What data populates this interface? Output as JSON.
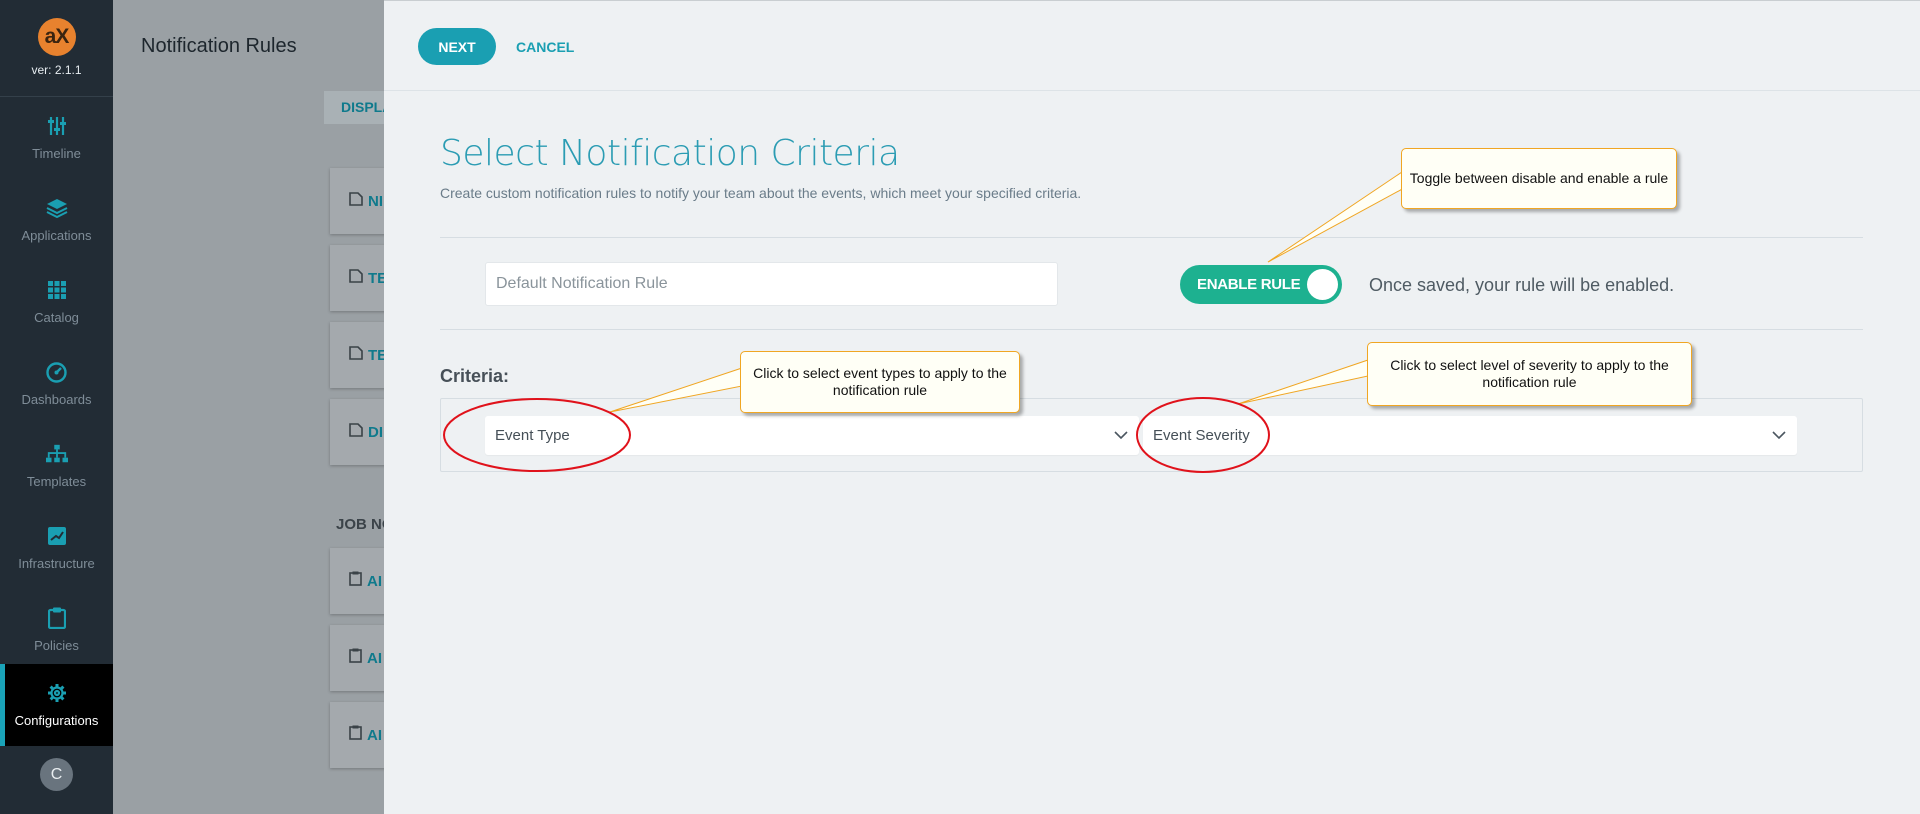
{
  "sidebar": {
    "logo_text": "aX",
    "version": "ver: 2.1.1",
    "items": [
      {
        "label": "Timeline",
        "icon": "sliders-icon"
      },
      {
        "label": "Applications",
        "icon": "layers-icon"
      },
      {
        "label": "Catalog",
        "icon": "grid-icon"
      },
      {
        "label": "Dashboards",
        "icon": "gauge-icon"
      },
      {
        "label": "Templates",
        "icon": "sitemap-icon"
      },
      {
        "label": "Infrastructure",
        "icon": "server-icon"
      },
      {
        "label": "Policies",
        "icon": "clipboard-icon"
      },
      {
        "label": "Configurations",
        "icon": "gear-icon"
      }
    ],
    "active_item": "Configurations",
    "avatar_initial": "C"
  },
  "background_page": {
    "title": "Notification Rules",
    "tab": "DISPLA",
    "cards": [
      "NI",
      "TE",
      "TE",
      "DI"
    ],
    "section_label": "JOB NO",
    "job_cards": [
      "AI",
      "AI",
      "AI"
    ]
  },
  "header": {
    "next_label": "NEXT",
    "cancel_label": "CANCEL"
  },
  "form": {
    "heading": "Select Notification Criteria",
    "subheading": "Create custom notification rules to notify your team about the events, which meet your specified criteria.",
    "rule_name_placeholder": "Default Notification Rule",
    "toggle_label": "ENABLE RULE",
    "toggle_enabled": true,
    "toggle_info": "Once saved, your rule will be enabled.",
    "criteria_label": "Criteria:",
    "event_type_label": "Event Type",
    "event_severity_label": "Event Severity"
  },
  "annotations": {
    "toggle_note": "Toggle between disable and enable a rule",
    "event_type_note": "Click to select event types to apply to the notification rule",
    "severity_note": "Click to select level of severity to apply to the notification rule"
  },
  "colors": {
    "accent": "#1a9fb2",
    "toggle_on": "#1db190",
    "sidebar_bg": "#222c35",
    "callout_border": "#f0a623",
    "highlight_ring": "#e0121b"
  }
}
